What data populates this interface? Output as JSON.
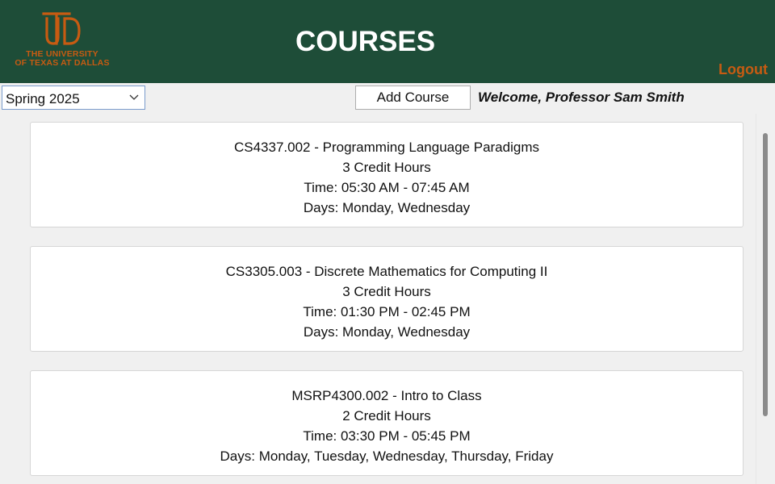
{
  "header": {
    "logo_text_line1": "THE UNIVERSITY",
    "logo_text_line2": "OF TEXAS AT DALLAS",
    "title": "COURSES",
    "logout_label": "Logout",
    "logo_icon": "utd-monogram-icon"
  },
  "toolbar": {
    "term_selected": "Spring 2025",
    "add_course_label": "Add Course",
    "welcome_text": "Welcome, Professor Sam Smith"
  },
  "courses": [
    {
      "title": "CS4337.002 - Programming Language Paradigms",
      "credits": "3 Credit Hours",
      "time": "Time: 05:30 AM - 07:45 AM",
      "days": "Days: Monday, Wednesday"
    },
    {
      "title": "CS3305.003 - Discrete Mathematics for Computing II",
      "credits": "3 Credit Hours",
      "time": "Time: 01:30 PM - 02:45 PM",
      "days": "Days: Monday, Wednesday"
    },
    {
      "title": "MSRP4300.002 - Intro to Class",
      "credits": "2 Credit Hours",
      "time": "Time: 03:30 PM - 05:45 PM",
      "days": "Days: Monday, Tuesday, Wednesday, Thursday, Friday"
    }
  ],
  "colors": {
    "header_bg": "#1e4d38",
    "accent_orange": "#c75b12",
    "page_bg": "#f0f0f0"
  }
}
